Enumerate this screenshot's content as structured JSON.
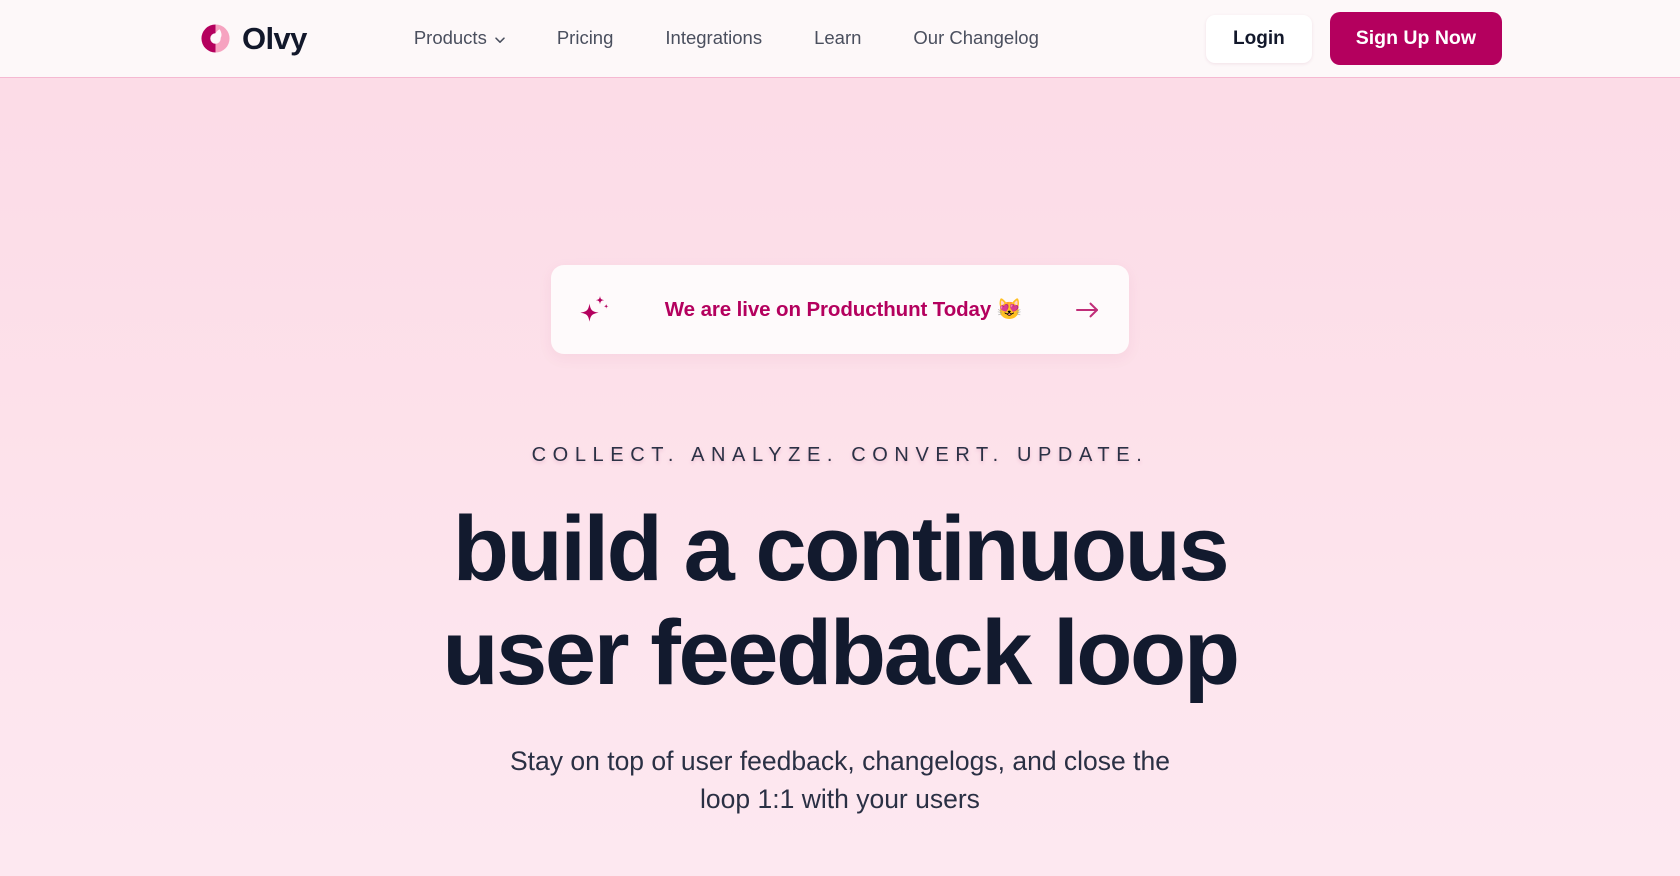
{
  "brand": {
    "name": "Olvy",
    "logo_icon": "olvy-droplet-logo",
    "colors": {
      "logo_dark": "#b4005e",
      "logo_light": "#f6a3c0"
    }
  },
  "header": {
    "nav": [
      {
        "label": "Products",
        "has_dropdown": true,
        "icon": "chevron-down-icon"
      },
      {
        "label": "Pricing",
        "has_dropdown": false
      },
      {
        "label": "Integrations",
        "has_dropdown": false
      },
      {
        "label": "Learn",
        "has_dropdown": false
      },
      {
        "label": "Our Changelog",
        "has_dropdown": false
      }
    ],
    "login_label": "Login",
    "signup_label": "Sign Up Now",
    "background": "#fdf8f9",
    "accent": "#b4005e"
  },
  "hero": {
    "announcement": {
      "sparkle_icon": "sparkle-icon",
      "text": "We are live on Producthunt Today 😻",
      "arrow_icon": "arrow-right-icon",
      "accent": "#b4005e"
    },
    "eyebrow": "COLLECT. ANALYZE. CONVERT. UPDATE.",
    "headline_line1": "build a continuous",
    "headline_line2": "user feedback loop",
    "subtitle_line1": "Stay on top of user feedback, changelogs, and close the",
    "subtitle_line2": "loop 1:1 with your users",
    "background_top": "#fcdbe6",
    "background_bottom": "#fde8f0",
    "heading_color": "#121a2e"
  }
}
